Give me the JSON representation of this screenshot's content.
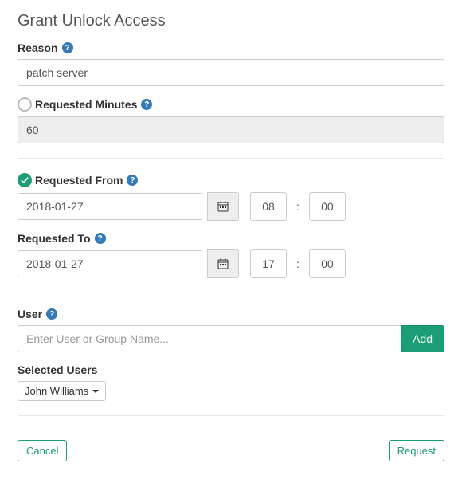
{
  "title": "Grant Unlock Access",
  "reason": {
    "label": "Reason",
    "value": "patch server"
  },
  "requested_minutes": {
    "label": "Requested Minutes",
    "value": "60",
    "selected": false
  },
  "requested_from": {
    "label": "Requested From",
    "date": "2018-01-27",
    "hour": "08",
    "minute": "00",
    "selected": true
  },
  "requested_to": {
    "label": "Requested To",
    "date": "2018-01-27",
    "hour": "17",
    "minute": "00"
  },
  "user": {
    "label": "User",
    "placeholder": "Enter User or Group Name...",
    "add_label": "Add"
  },
  "selected_users": {
    "label": "Selected Users",
    "items": [
      "John Williams"
    ]
  },
  "footer": {
    "cancel": "Cancel",
    "request": "Request"
  },
  "colon": ":"
}
